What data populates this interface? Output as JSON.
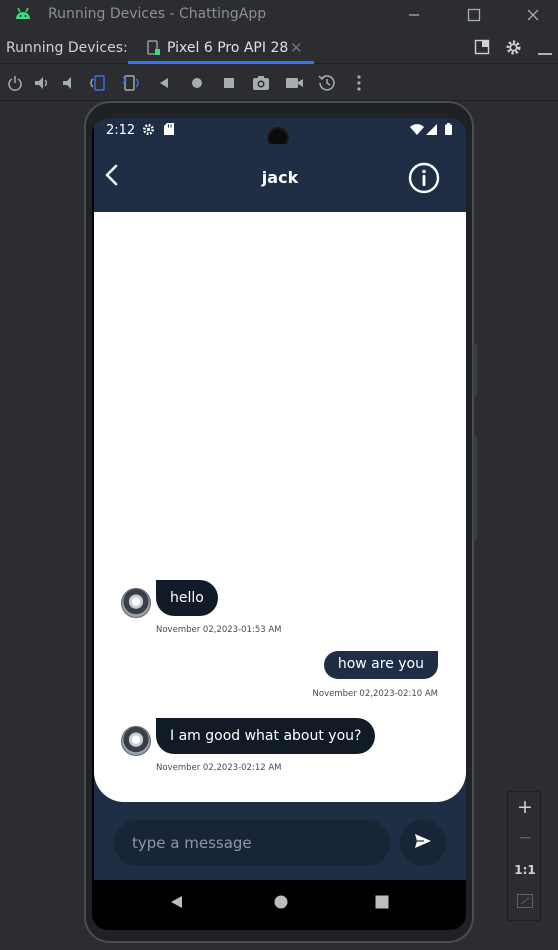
{
  "window": {
    "title": "Running Devices - ChattingApp"
  },
  "tabbar": {
    "label": "Running Devices:",
    "tab_label": "Pixel 6 Pro API 28"
  },
  "phone": {
    "status_time": "2:12",
    "contact_name": "jack",
    "messages": [
      {
        "direction": "in",
        "text": "hello",
        "time": "November 02,2023-01:53 AM"
      },
      {
        "direction": "out",
        "text": "how are you",
        "time": "November 02,2023-02:10 AM"
      },
      {
        "direction": "in",
        "text": "I am good what about you?",
        "time": "November 02,2023-02:12 AM"
      }
    ],
    "input_placeholder": "type a message"
  },
  "zoom": {
    "plus": "+",
    "minus": "−",
    "one_to_one": "1:1"
  },
  "colors": {
    "app_primary": "#1f2d45",
    "ide_bg": "#2b2d30",
    "tab_accent": "#3574f0"
  }
}
